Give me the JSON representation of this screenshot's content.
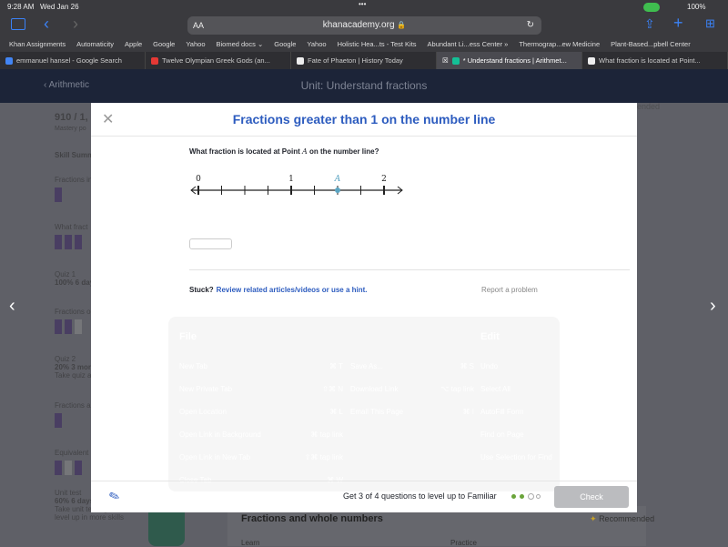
{
  "status": {
    "time": "9:28 AM",
    "date": "Wed Jan 26",
    "battery": "100%"
  },
  "browser": {
    "url": "khanacademy.org",
    "text_size": "AA",
    "bookmarks": [
      "Khan Assignments",
      "Automaticity",
      "Apple",
      "Google",
      "Yahoo",
      "Biomed docs ⌄",
      "Google",
      "Yahoo",
      "Holistic Hea...ts - Test Kits",
      "Abundant Li...ess Center »",
      "Thermograp...ew Medicine",
      "Plant-Based...pbell Center"
    ],
    "tabs": [
      {
        "label": "emmanuel hansel - Google Search",
        "color": "#4285f4"
      },
      {
        "label": "Twelve Olympian Greek Gods (an...",
        "color": "#e53935"
      },
      {
        "label": "Fate of Phaeton | History Today",
        "color": "#222222"
      },
      {
        "label": "* Understand fractions | Arithmet...",
        "color": "#14bf96"
      },
      {
        "label": "What fraction is located at Point...",
        "color": "#222222"
      }
    ]
  },
  "nav": {
    "back": "Arithmetic",
    "title": "Unit: Understand fractions"
  },
  "sidebar": {
    "points": "910 / 1,",
    "points_sub": "Mastery po",
    "skill_summary": "Skill Summ",
    "items": [
      {
        "title": "Fractions in",
        "bars": 1
      },
      {
        "title": "What fract",
        "bars": 3
      },
      {
        "title": "Quiz 1",
        "detail": "100% 6 day"
      },
      {
        "title": "Fractions o",
        "bars": 3
      },
      {
        "title": "Quiz 2",
        "detail": "20% 3 mor",
        "note": "Take quiz a"
      },
      {
        "title": "Fractions a",
        "bars": 1
      },
      {
        "title": "Equivalent",
        "bars": 3
      },
      {
        "title": "Unit test",
        "detail": "60% 6 days",
        "note": "Take unit test again to level up in more skills"
      }
    ]
  },
  "background": {
    "recommended": "Recommended",
    "recommended_top": "ended",
    "section": "Fractions and whole numbers",
    "learn": "Learn",
    "practice": "Practice"
  },
  "modal": {
    "title": "Fractions greater than 1 on the number line",
    "question_pre": "What fraction is located at Point ",
    "point_label": "A",
    "question_post": " on the number line?",
    "number_line": {
      "labels": [
        "0",
        "1",
        "2"
      ],
      "ticks_per_unit": 4,
      "point_value": 1.5,
      "point_color": "#5aa4c2"
    },
    "answer_value": "",
    "stuck": "Stuck?",
    "hint_link": "Review related articles/videos or use a hint.",
    "report": "Report a problem",
    "level_up": "Get 3 of 4 questions to level up to Familiar",
    "progress": {
      "done": 2,
      "total": 4
    },
    "check": "Check"
  },
  "shortcut_overlay": {
    "file": "File",
    "edit": "Edit",
    "col1": [
      [
        "New Tab",
        "⌘ T"
      ],
      [
        "New Private Tab",
        "⇧⌘ N"
      ],
      [
        "Open Location",
        "⌘ L"
      ],
      [
        "Open Link in Background",
        "⌘ tap link"
      ],
      [
        "Open Link in New Tab",
        "⇧⌘ tap link"
      ],
      [
        "Close Tab",
        "⌘ W"
      ]
    ],
    "col2": [
      [
        "Save As...",
        "⌘ S"
      ],
      [
        "Download Link",
        "⌥ tap link"
      ],
      [
        "Email This Page",
        "⌘ I"
      ]
    ],
    "col3": [
      "Undo",
      "Select All",
      "AutoFill Form",
      "Find on Page",
      "Use Selection for Find"
    ]
  }
}
